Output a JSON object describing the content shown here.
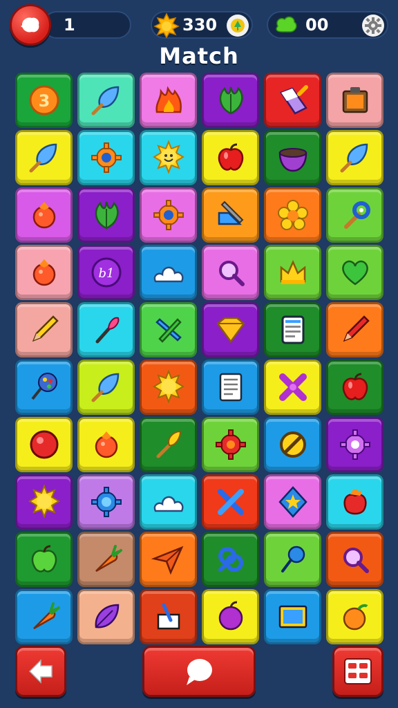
{
  "header": {
    "level_value": "1",
    "coins_value": "330",
    "gems_value": "00",
    "title": "Match"
  },
  "colors": {
    "background": "#1f3a63",
    "button_red": "#e2312b"
  },
  "board": {
    "rows": [
      [
        {
          "bg": "#1aa63a",
          "icon": "number-3-coin",
          "text": "3"
        },
        {
          "bg": "#4ee4b8",
          "icon": "leaf-brush"
        },
        {
          "bg": "#f07ae6",
          "icon": "flame"
        },
        {
          "bg": "#8b1fc9",
          "icon": "green-leaf"
        },
        {
          "bg": "#e72525",
          "icon": "eraser"
        },
        {
          "bg": "#f4a3a6",
          "icon": "clipboard-box"
        }
      ],
      [
        {
          "bg": "#f6ee1b",
          "icon": "leaf-brush"
        },
        {
          "bg": "#2ad6ec",
          "icon": "gear"
        },
        {
          "bg": "#2ad6ec",
          "icon": "smiling-sun"
        },
        {
          "bg": "#f6ee1b",
          "icon": "apple"
        },
        {
          "bg": "#1f8d2a",
          "icon": "bowl"
        },
        {
          "bg": "#f6ee1b",
          "icon": "leaf-brush"
        }
      ],
      [
        {
          "bg": "#d85ae8",
          "icon": "berry"
        },
        {
          "bg": "#8b1fc9",
          "icon": "green-leaf"
        },
        {
          "bg": "#e86ee6",
          "icon": "gear"
        },
        {
          "bg": "#ff9b1a",
          "icon": "ruler-pencil"
        },
        {
          "bg": "#ff7a1a",
          "icon": "flower"
        },
        {
          "bg": "#6ed33a",
          "icon": "wrench"
        }
      ],
      [
        {
          "bg": "#f7a4b0",
          "icon": "berry"
        },
        {
          "bg": "#8b1fc9",
          "icon": "purple-coin"
        },
        {
          "bg": "#1e9be6",
          "icon": "cloud"
        },
        {
          "bg": "#e86ee6",
          "icon": "magnifier"
        },
        {
          "bg": "#6ed33a",
          "icon": "crown"
        },
        {
          "bg": "#6ed33a",
          "icon": "heart"
        }
      ],
      [
        {
          "bg": "#f4a7a0",
          "icon": "pencil"
        },
        {
          "bg": "#2ad6ec",
          "icon": "brush"
        },
        {
          "bg": "#4fd34a",
          "icon": "pencil-blue"
        },
        {
          "bg": "#8b1fc9",
          "icon": "diamond"
        },
        {
          "bg": "#1f8d2a",
          "icon": "tablet"
        },
        {
          "bg": "#ff7a1a",
          "icon": "pencil-red"
        }
      ],
      [
        {
          "bg": "#1e9be6",
          "icon": "palette"
        },
        {
          "bg": "#c8ee1b",
          "icon": "leaf-brush"
        },
        {
          "bg": "#f25a14",
          "icon": "sun"
        },
        {
          "bg": "#1e9be6",
          "icon": "document"
        },
        {
          "bg": "#f6ee1b",
          "icon": "cross-bone"
        },
        {
          "bg": "#1f8d2a",
          "icon": "apple"
        }
      ],
      [
        {
          "bg": "#f6ee1b",
          "icon": "red-ball"
        },
        {
          "bg": "#f6ee1b",
          "icon": "berry"
        },
        {
          "bg": "#1f8d2a",
          "icon": "brush-yellow"
        },
        {
          "bg": "#6ed33a",
          "icon": "gear-red"
        },
        {
          "bg": "#1e9be6",
          "icon": "no-sign"
        },
        {
          "bg": "#8b1fc9",
          "icon": "gear-purple"
        }
      ],
      [
        {
          "bg": "#8b1fc9",
          "icon": "sun"
        },
        {
          "bg": "#c07ae8",
          "icon": "gear-blue"
        },
        {
          "bg": "#2ad6ec",
          "icon": "cloud"
        },
        {
          "bg": "#f03a1a",
          "icon": "crossed-tools"
        },
        {
          "bg": "#e86ee6",
          "icon": "star-badge"
        },
        {
          "bg": "#2ad6ec",
          "icon": "flame-apple"
        }
      ],
      [
        {
          "bg": "#1f9a30",
          "icon": "green-apple"
        },
        {
          "bg": "#c48a6a",
          "icon": "carrot"
        },
        {
          "bg": "#ff7a1a",
          "icon": "paper-plane"
        },
        {
          "bg": "#1f8d2a",
          "icon": "knot"
        },
        {
          "bg": "#6ed33a",
          "icon": "pin"
        },
        {
          "bg": "#f25a14",
          "icon": "magnifier"
        }
      ],
      [
        {
          "bg": "#1e9be6",
          "icon": "carrot"
        },
        {
          "bg": "#f4b18e",
          "icon": "purple-leaf"
        },
        {
          "bg": "#e0401a",
          "icon": "note-card"
        },
        {
          "bg": "#f6ee1b",
          "icon": "plum"
        },
        {
          "bg": "#1e9be6",
          "icon": "picture-frame"
        },
        {
          "bg": "#f6ee1b",
          "icon": "orange-fruit"
        }
      ]
    ]
  },
  "footer": {
    "back_icon": "back-arrow-icon",
    "chat_icon": "chat-bubble-icon",
    "menu_icon": "menu-board-icon"
  }
}
